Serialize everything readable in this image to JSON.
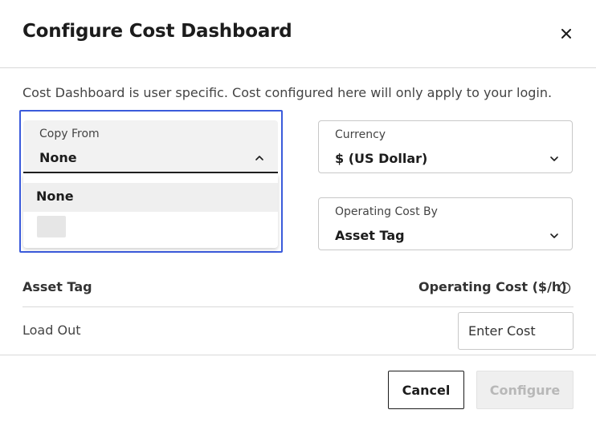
{
  "dialog": {
    "title": "Configure Cost Dashboard",
    "info_text": "Cost Dashboard is user specific. Cost configured here will only apply to your login."
  },
  "copy_from": {
    "label": "Copy From",
    "value": "None",
    "options": [
      "None",
      ""
    ]
  },
  "currency": {
    "label": "Currency",
    "value": "$ (US Dollar)"
  },
  "operating_cost_by": {
    "label": "Operating Cost By",
    "value": "Asset Tag"
  },
  "table": {
    "col_asset_tag": "Asset Tag",
    "col_operating_cost": "Operating Cost ($/h)",
    "rows": [
      {
        "asset_tag": "Load Out",
        "cost_placeholder": "Enter Cost"
      }
    ]
  },
  "footer": {
    "cancel_label": "Cancel",
    "configure_label": "Configure"
  },
  "colors": {
    "focus": "#3b5bdb",
    "disabled_text": "#b8b8b8"
  },
  "icons": {
    "close": "close-icon",
    "chevron_up": "chevron-up-icon",
    "chevron_down": "chevron-down-icon",
    "info": "info-icon"
  }
}
